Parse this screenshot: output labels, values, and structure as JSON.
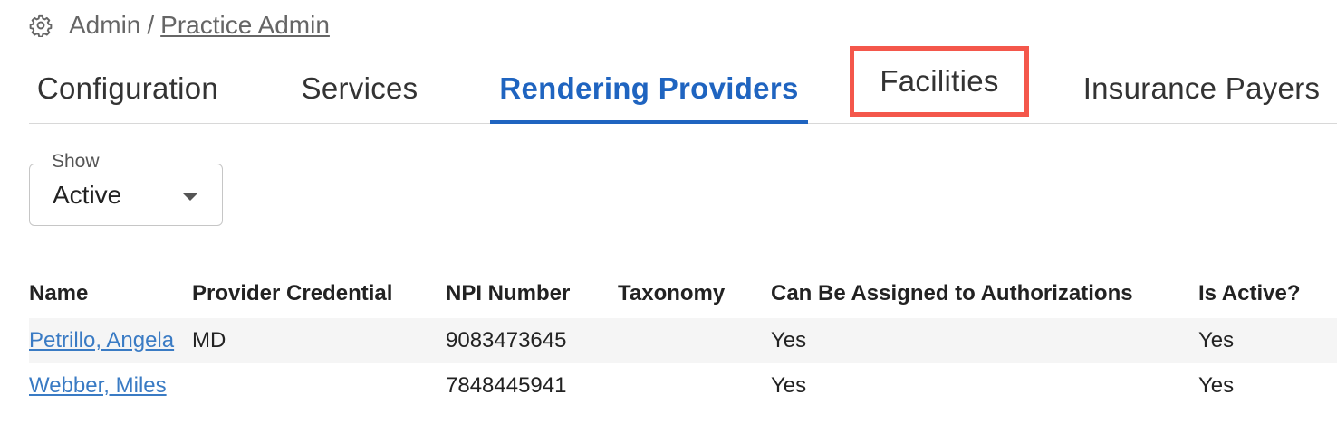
{
  "breadcrumb": {
    "icon": "gear-icon",
    "root": "Admin",
    "separator": "/",
    "current": "Practice Admin"
  },
  "tabs": [
    {
      "label": "Configuration",
      "active": false
    },
    {
      "label": "Services",
      "active": false
    },
    {
      "label": "Rendering Providers",
      "active": true
    },
    {
      "label": "Facilities",
      "active": false,
      "highlighted": true
    },
    {
      "label": "Insurance Payers",
      "active": false
    }
  ],
  "filter": {
    "label": "Show",
    "value": "Active"
  },
  "table": {
    "columns": [
      "Name",
      "Provider Credential",
      "NPI Number",
      "Taxonomy",
      "Can Be Assigned to Authorizations",
      "Is Active?"
    ],
    "rows": [
      {
        "name": "Petrillo, Angela",
        "credential": "MD",
        "npi": "9083473645",
        "taxonomy": "",
        "assignable": "Yes",
        "active": "Yes"
      },
      {
        "name": "Webber, Miles",
        "credential": "",
        "npi": "7848445941",
        "taxonomy": "",
        "assignable": "Yes",
        "active": "Yes"
      }
    ]
  },
  "colors": {
    "accent": "#1f64c0",
    "link": "#3a7bc4",
    "highlight": "#f4574b",
    "row_stripe": "#f5f5f5"
  }
}
